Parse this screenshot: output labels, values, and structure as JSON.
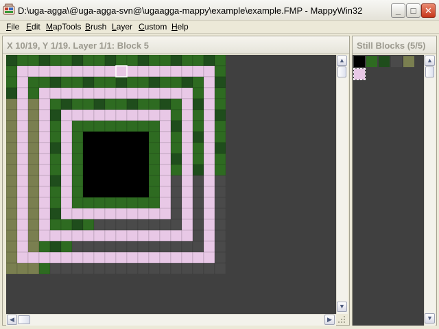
{
  "window": {
    "title": "D:\\uga-agga\\@uga-agga-svn@\\ugaagga-mappy\\example\\example.FMP - MappyWin32",
    "minimize": "_",
    "maximize": "□",
    "close": "✕"
  },
  "menu": {
    "items": [
      "File",
      "Edit",
      "MapTools",
      "Brush",
      "Layer",
      "Custom",
      "Help"
    ]
  },
  "map_panel": {
    "status": "X 10/19, Y 1/19. Layer 1/1: Block 5",
    "map_width_tiles": 20,
    "map_height_tiles": 20,
    "cursor_tile": [
      10,
      1
    ]
  },
  "blocks_panel": {
    "title": "Still Blocks (5/5)",
    "blocks": [
      {
        "name": "black-block",
        "color": "#000000"
      },
      {
        "name": "grass-block",
        "color": "#2e6b21"
      },
      {
        "name": "dark-grass-block",
        "color": "#1f4d1c"
      },
      {
        "name": "cobblestone-block",
        "color": "#4a4a4a"
      },
      {
        "name": "moss-block",
        "color": "#7a7f50"
      },
      {
        "name": "pink-stone-block",
        "color": "#e8c8e6"
      }
    ]
  },
  "scroll": {
    "up": "▲",
    "down": "▼",
    "left": "◀",
    "right": "▶"
  }
}
